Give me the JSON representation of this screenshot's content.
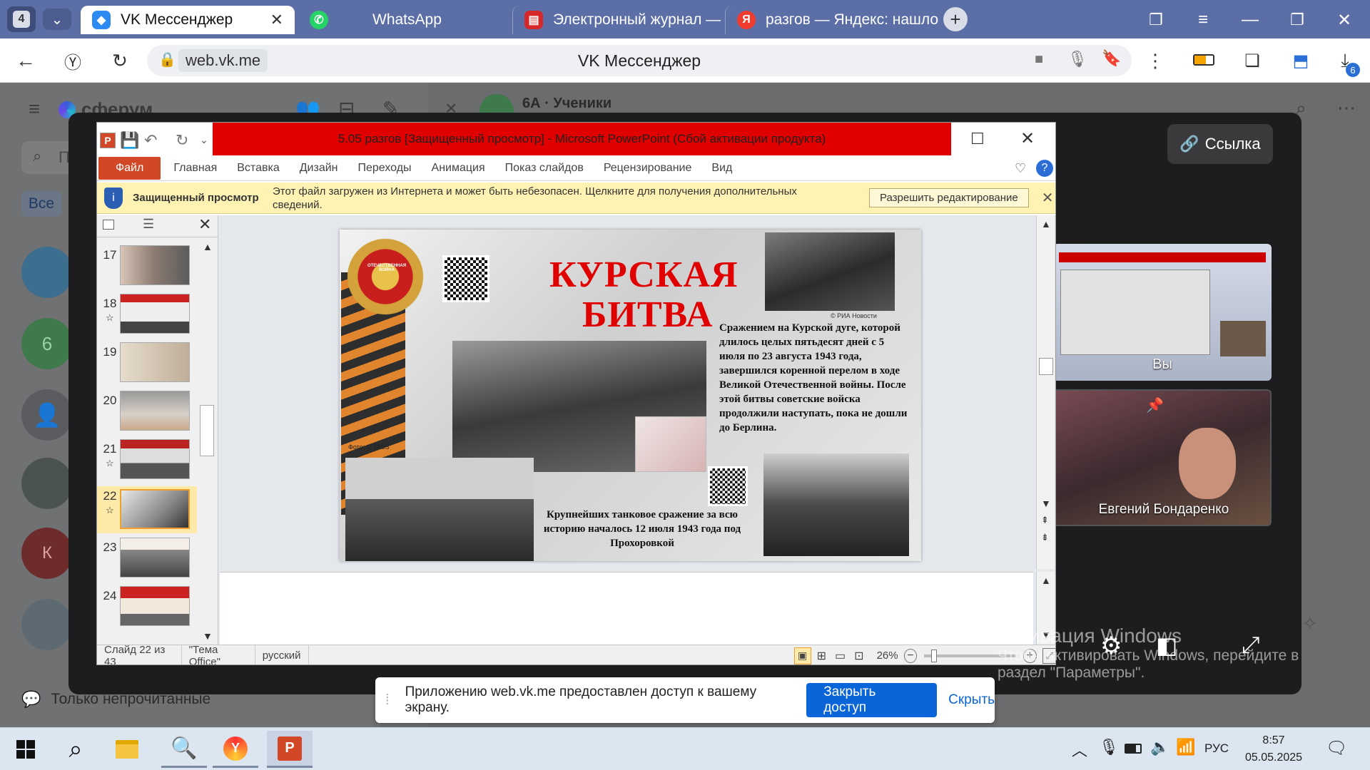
{
  "browser": {
    "tab_count_badge": "4",
    "tabs": [
      {
        "label": "VK Мессенджер",
        "icon": "vk-messenger-icon",
        "active": true
      },
      {
        "label": "WhatsApp",
        "icon": "whatsapp-icon",
        "active": false
      },
      {
        "label": "Электронный журнал — L",
        "icon": "journal-icon",
        "active": false
      },
      {
        "label": "разгов — Яндекс: нашлос",
        "icon": "yandex-icon",
        "active": false
      }
    ],
    "url": "web.vk.me",
    "page_title": "VK Мессенджер",
    "downloads_badge": "6"
  },
  "vk": {
    "brand": "сферум",
    "search_placeholder": "П",
    "filter_all": "Все",
    "chat_title": "6А · Ученики",
    "avatar_badge": "6",
    "contact_initial": "К",
    "unread_only": "Только непрочитанные",
    "link_button": "Ссылка",
    "close_x": "×"
  },
  "powerpoint": {
    "title": "5.05 разгов [Защищенный просмотр] - Microsoft PowerPoint (Сбой активации продукта)",
    "ribbon_tabs": [
      "Файл",
      "Главная",
      "Вставка",
      "Дизайн",
      "Переходы",
      "Анимация",
      "Показ слайдов",
      "Рецензирование",
      "Вид"
    ],
    "protected_label": "Защищенный просмотр",
    "protected_text": "Этот файл загружен из Интернета и может быть небезопасен. Щелкните для получения дополнительных сведений.",
    "enable_editing": "Разрешить редактирование",
    "thumbnails": [
      {
        "num": "17",
        "star": ""
      },
      {
        "num": "18",
        "star": "☆"
      },
      {
        "num": "19",
        "star": ""
      },
      {
        "num": "20",
        "star": ""
      },
      {
        "num": "21",
        "star": "☆"
      },
      {
        "num": "22",
        "star": "☆"
      },
      {
        "num": "23",
        "star": ""
      },
      {
        "num": "24",
        "star": ""
      }
    ],
    "slide": {
      "title_line1": "КУРСКАЯ",
      "title_line2": "БИТВА",
      "medal_text": "ОТЕЧЕСТВЕННАЯ ВОЙНА",
      "credit_ria": "© РИА Новости",
      "credit_tass": "Фото: © TASS",
      "body_text": "Сражением на Курской дуге, которой длилось целых пятьдесят дней с 5 июля по 23 августа 1943 года, завершился коренной перелом в ходе Великой Отечественной войны. После этой битвы советские войска продолжили наступать, пока не дошли до Берлина.",
      "caption_text": "Крупнейших танковое сражение за всю историю началось 12 июля 1943 года под Прохоровкой"
    },
    "status": {
      "slide_info": "Слайд 22 из 43",
      "theme": "\"Тема Office\"",
      "language": "русский",
      "zoom": "26%"
    }
  },
  "video": {
    "self_label": "Вы",
    "participant_name": "Евгений Бондаренко"
  },
  "windows_watermark": {
    "line1": "Активация Windows",
    "line2": "Чтобы активировать Windows, перейдите в",
    "line3": "раздел \"Параметры\"."
  },
  "share_notice": {
    "text": "Приложению web.vk.me предоставлен доступ к вашему экрану.",
    "close_access": "Закрыть доступ",
    "hide": "Скрыть"
  },
  "taskbar": {
    "language": "РУС",
    "time": "8:57",
    "date": "05.05.2025"
  },
  "colors": {
    "browser_tabbar": "#5b6ea6",
    "ppt_red_title": "#e00000",
    "ppt_file_tab": "#d24726",
    "slide_title_red": "#e00000",
    "share_button": "#0a66d8"
  }
}
